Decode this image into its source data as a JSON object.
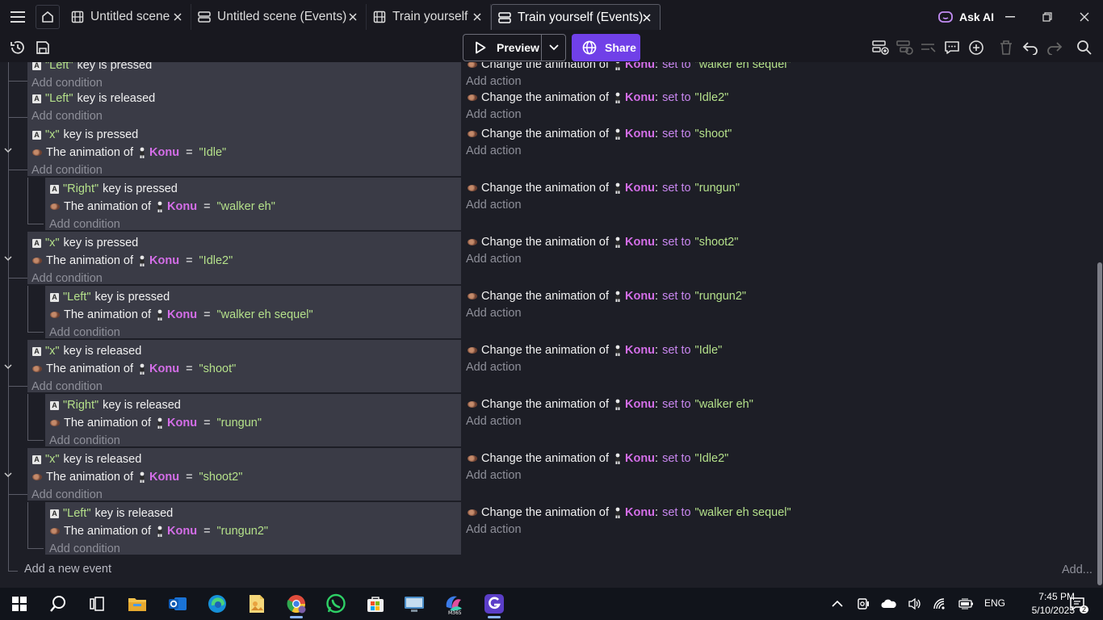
{
  "titlebar": {
    "tabs": [
      {
        "label": "Untitled scene",
        "icon": "scene-icon"
      },
      {
        "label": "Untitled scene (Events)",
        "icon": "events-icon"
      },
      {
        "label": "Train yourself",
        "icon": "scene-icon"
      },
      {
        "label": "Train yourself (Events)",
        "icon": "events-icon",
        "active": true
      }
    ],
    "ask_ai": "Ask AI"
  },
  "toolbar": {
    "preview_label": "Preview",
    "share_label": "Share"
  },
  "events": [
    {
      "cond": [
        {
          "kind": "key",
          "key": "\"Left\"",
          "text": "key is pressed"
        }
      ],
      "add_condition": "Add condition",
      "actions": [
        {
          "prefix": "Change the animation of",
          "object": "Konu",
          "setto": "set to",
          "value": "\"walker eh sequel\""
        }
      ],
      "add_action": "Add action"
    },
    {
      "cond": [
        {
          "kind": "key",
          "key": "\"Left\"",
          "text": "key is released"
        }
      ],
      "add_condition": "Add condition",
      "actions": [
        {
          "prefix": "Change the animation of",
          "object": "Konu",
          "setto": "set to",
          "value": "\"Idle2\""
        }
      ],
      "add_action": "Add action"
    },
    {
      "cond": [
        {
          "kind": "key",
          "key": "\"x\"",
          "text": "key is pressed"
        },
        {
          "kind": "anim",
          "text": "The animation of",
          "object": "Konu",
          "op": "=",
          "value": "\"Idle\""
        }
      ],
      "add_condition": "Add condition",
      "actions": [
        {
          "prefix": "Change the animation of",
          "object": "Konu",
          "setto": "set to",
          "value": "\"shoot\""
        }
      ],
      "add_action": "Add action"
    },
    {
      "cond": [
        {
          "kind": "key",
          "key": "\"Right\"",
          "text": "key is pressed"
        },
        {
          "kind": "anim",
          "text": "The animation of",
          "object": "Konu",
          "op": "=",
          "value": "\"walker eh\""
        }
      ],
      "add_condition": "Add condition",
      "actions": [
        {
          "prefix": "Change the animation of",
          "object": "Konu",
          "setto": "set to",
          "value": "\"rungun\""
        }
      ],
      "add_action": "Add action"
    },
    {
      "cond": [
        {
          "kind": "key",
          "key": "\"x\"",
          "text": "key is pressed"
        },
        {
          "kind": "anim",
          "text": "The animation of",
          "object": "Konu",
          "op": "=",
          "value": "\"Idle2\""
        }
      ],
      "add_condition": "Add condition",
      "actions": [
        {
          "prefix": "Change the animation of",
          "object": "Konu",
          "setto": "set to",
          "value": "\"shoot2\""
        }
      ],
      "add_action": "Add action"
    },
    {
      "cond": [
        {
          "kind": "key",
          "key": "\"Left\"",
          "text": "key is pressed"
        },
        {
          "kind": "anim",
          "text": "The animation of",
          "object": "Konu",
          "op": "=",
          "value": "\"walker eh sequel\""
        }
      ],
      "add_condition": "Add condition",
      "actions": [
        {
          "prefix": "Change the animation of",
          "object": "Konu",
          "setto": "set to",
          "value": "\"rungun2\""
        }
      ],
      "add_action": "Add action"
    },
    {
      "cond": [
        {
          "kind": "key",
          "key": "\"x\"",
          "text": "key is released"
        },
        {
          "kind": "anim",
          "text": "The animation of",
          "object": "Konu",
          "op": "=",
          "value": "\"shoot\""
        }
      ],
      "add_condition": "Add condition",
      "actions": [
        {
          "prefix": "Change the animation of",
          "object": "Konu",
          "setto": "set to",
          "value": "\"Idle\""
        }
      ],
      "add_action": "Add action"
    },
    {
      "cond": [
        {
          "kind": "key",
          "key": "\"Right\"",
          "text": "key is released"
        },
        {
          "kind": "anim",
          "text": "The animation of",
          "object": "Konu",
          "op": "=",
          "value": "\"rungun\""
        }
      ],
      "add_condition": "Add condition",
      "actions": [
        {
          "prefix": "Change the animation of",
          "object": "Konu",
          "setto": "set to",
          "value": "\"walker eh\""
        }
      ],
      "add_action": "Add action"
    },
    {
      "cond": [
        {
          "kind": "key",
          "key": "\"x\"",
          "text": "key is released"
        },
        {
          "kind": "anim",
          "text": "The animation of",
          "object": "Konu",
          "op": "=",
          "value": "\"shoot2\""
        }
      ],
      "add_condition": "Add condition",
      "actions": [
        {
          "prefix": "Change the animation of",
          "object": "Konu",
          "setto": "set to",
          "value": "\"Idle2\""
        }
      ],
      "add_action": "Add action"
    },
    {
      "cond": [
        {
          "kind": "key",
          "key": "\"Left\"",
          "text": "key is released"
        },
        {
          "kind": "anim",
          "text": "The animation of",
          "object": "Konu",
          "op": "=",
          "value": "\"rungun2\""
        }
      ],
      "add_condition": "Add condition",
      "actions": [
        {
          "prefix": "Change the animation of",
          "object": "Konu",
          "setto": "set to",
          "value": "\"walker eh sequel\""
        }
      ],
      "add_action": "Add action"
    }
  ],
  "footer": {
    "add_event": "Add a new event",
    "add_more": "Add..."
  },
  "taskbar": {
    "time": "7:45 PM",
    "date": "5/10/2025",
    "lang": "ENG",
    "apps": [
      "start-icon",
      "search-icon",
      "task-view-icon",
      "file-explorer-icon",
      "outlook-icon",
      "edge-icon",
      "photos-icon",
      "chrome-icon",
      "whatsapp-icon",
      "store-icon",
      "remote-desktop-icon",
      "m365-icon",
      "gdevelop-icon"
    ]
  }
}
